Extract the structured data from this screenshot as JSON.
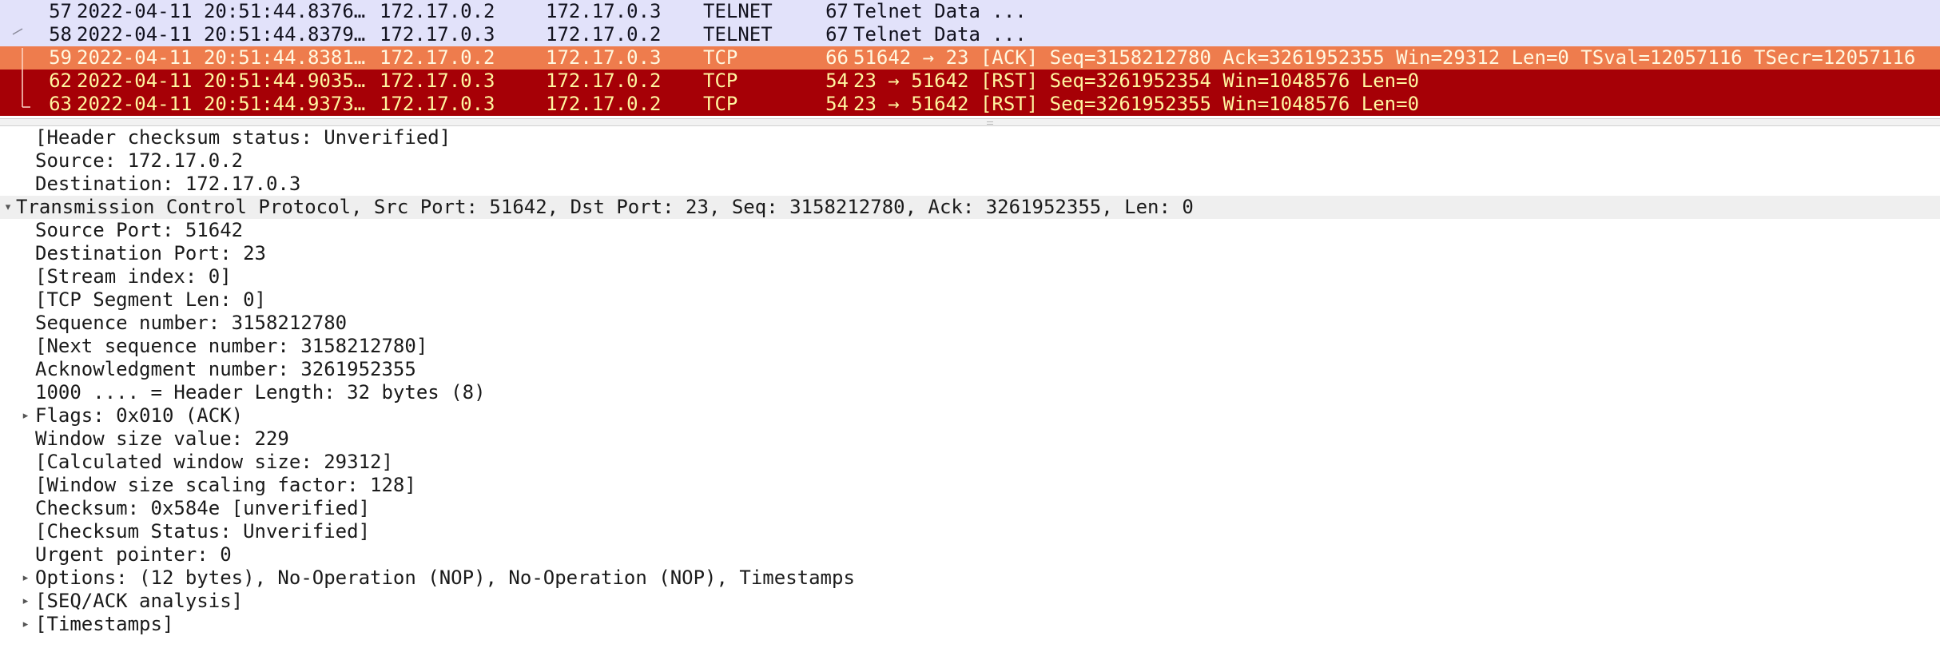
{
  "packets": [
    {
      "no": "57",
      "time": "2022-04-11 20:51:44.8376…",
      "src": "172.17.0.2",
      "dst": "172.17.0.3",
      "proto": "TELNET",
      "len": "67",
      "info": "Telnet Data ..."
    },
    {
      "no": "58",
      "time": "2022-04-11 20:51:44.8379…",
      "src": "172.17.0.3",
      "dst": "172.17.0.2",
      "proto": "TELNET",
      "len": "67",
      "info": "Telnet Data ..."
    },
    {
      "no": "59",
      "time": "2022-04-11 20:51:44.8381…",
      "src": "172.17.0.2",
      "dst": "172.17.0.3",
      "proto": "TCP",
      "len": "66",
      "info": "51642 → 23 [ACK] Seq=3158212780 Ack=3261952355 Win=29312 Len=0 TSval=12057116 TSecr=12057116"
    },
    {
      "no": "62",
      "time": "2022-04-11 20:51:44.9035…",
      "src": "172.17.0.3",
      "dst": "172.17.0.2",
      "proto": "TCP",
      "len": "54",
      "info": "23 → 51642 [RST] Seq=3261952354 Win=1048576 Len=0"
    },
    {
      "no": "63",
      "time": "2022-04-11 20:51:44.9373…",
      "src": "172.17.0.3",
      "dst": "172.17.0.2",
      "proto": "TCP",
      "len": "54",
      "info": "23 → 51642 [RST] Seq=3261952355 Win=1048576 Len=0"
    }
  ],
  "details": {
    "ip_checksum_status": "[Header checksum status: Unverified]",
    "ip_source": "Source: 172.17.0.2",
    "ip_destination": "Destination: 172.17.0.3",
    "tcp_header": "Transmission Control Protocol, Src Port: 51642, Dst Port: 23, Seq: 3158212780, Ack: 3261952355, Len: 0",
    "src_port": "Source Port: 51642",
    "dst_port": "Destination Port: 23",
    "stream_index": "[Stream index: 0]",
    "segment_len": "[TCP Segment Len: 0]",
    "seq_number": "Sequence number: 3158212780",
    "next_seq": "[Next sequence number: 3158212780]",
    "ack_number": "Acknowledgment number: 3261952355",
    "header_length": "1000 .... = Header Length: 32 bytes (8)",
    "flags": "Flags: 0x010 (ACK)",
    "window_value": "Window size value: 229",
    "calc_window": "[Calculated window size: 29312]",
    "window_scaling": "[Window size scaling factor: 128]",
    "checksum": "Checksum: 0x584e [unverified]",
    "checksum_status": "[Checksum Status: Unverified]",
    "urgent_pointer": "Urgent pointer: 0",
    "options": "Options: (12 bytes), No-Operation (NOP), No-Operation (NOP), Timestamps",
    "seq_ack_analysis": "[SEQ/ACK analysis]",
    "timestamps": "[Timestamps]"
  },
  "glyphs": {
    "expanded": "▾",
    "collapsed": "▸"
  },
  "colors": {
    "telnet_row": "#e2e2fa",
    "selected_row": "#ee7c4d",
    "rst_row": "#a60006",
    "rst_text": "#fff5a0"
  }
}
